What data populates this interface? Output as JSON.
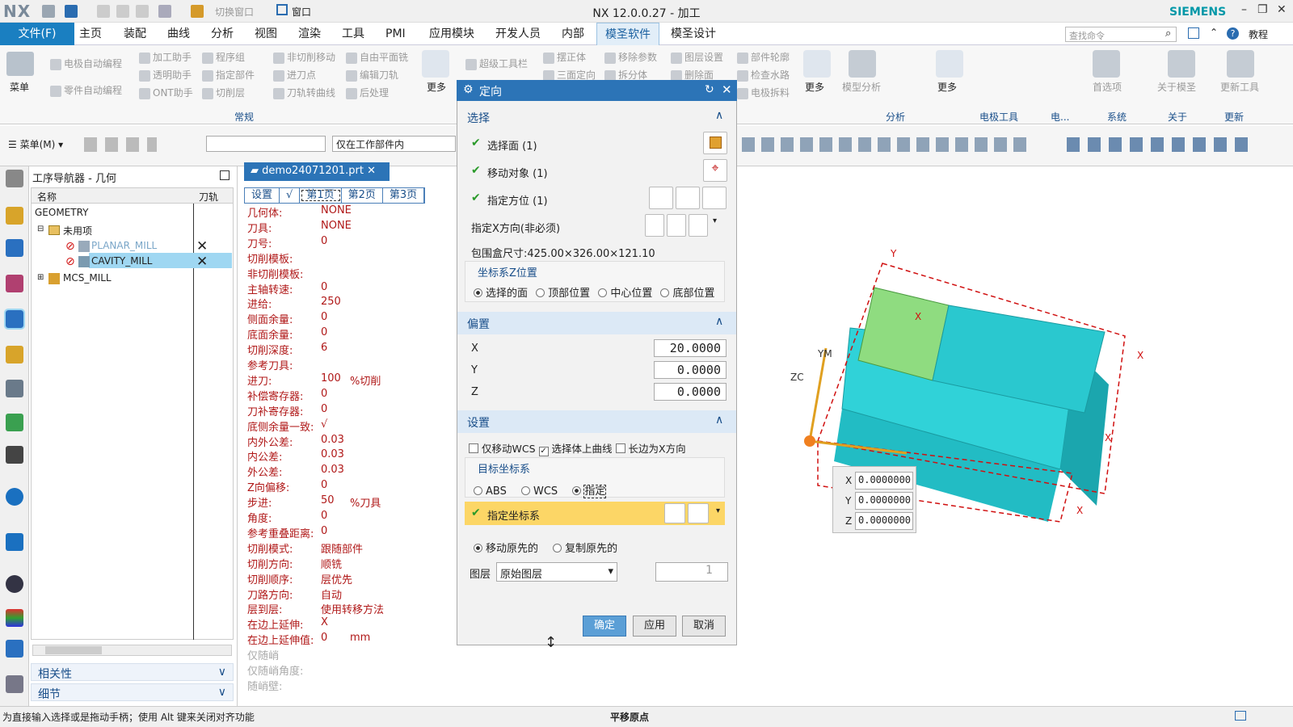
{
  "titlebar": {
    "logo": "NX",
    "title": "NX 12.0.0.27 - 加工",
    "brand": "SIEMENS",
    "switch_window": "切换窗口",
    "window_menu": "窗口"
  },
  "menubar": {
    "file": "文件(F)",
    "tabs": [
      "主页",
      "装配",
      "曲线",
      "分析",
      "视图",
      "渲染",
      "工具",
      "PMI",
      "应用模块",
      "开发人员",
      "内部",
      "模圣软件",
      "模圣设计"
    ],
    "active_tab": "模圣软件",
    "search_placeholder": "查找命令",
    "tutorial": "教程"
  },
  "ribbon": {
    "menu_label": "菜单",
    "group1": [
      "电极自动编程",
      "零件自动编程",
      "加工助手",
      "透明助手",
      "ONT助手",
      "程序组",
      "指定部件",
      "切削层",
      "非切削移动",
      "进刀点",
      "刀轨转曲线",
      "自由平面铣",
      "编辑刀轨",
      "后处理"
    ],
    "more": "更多",
    "group1_name": "常规",
    "group2": [
      "超级工具栏",
      "摆正体",
      "三面定向",
      "移除参数",
      "拆分体",
      "图层设置",
      "删除面",
      "部件轮廓",
      "检查水路",
      "电极拆料"
    ],
    "group3": [
      "模型分析",
      "首选项",
      "关于模圣",
      "更新工具"
    ],
    "group_names": [
      "分析",
      "电极工具",
      "电...",
      "系统",
      "关于",
      "更新"
    ]
  },
  "toolbar2": {
    "menu": "菜单(M)",
    "filter": "仅在工作部件内"
  },
  "navigator": {
    "title": "工序导航器 - 几何",
    "col_name": "名称",
    "col_path": "刀轨",
    "rows": [
      "GEOMETRY",
      "未用项",
      "PLANAR_MILL",
      "CAVITY_MILL",
      "MCS_MILL"
    ],
    "related": "相关性",
    "details": "细节"
  },
  "doc": {
    "tab": "demo24071201.prt"
  },
  "info": {
    "tabs": [
      "设置",
      "√",
      "第1页",
      "第2页",
      "第3页"
    ],
    "rows": [
      {
        "k": "几何体:",
        "v": "NONE"
      },
      {
        "k": "刀具:",
        "v": "NONE"
      },
      {
        "k": "刀号:",
        "v": "0"
      },
      {
        "k": "切削模板:",
        "v": ""
      },
      {
        "k": "非切削模板:",
        "v": ""
      },
      {
        "k": "主轴转速:",
        "v": "0"
      },
      {
        "k": "进给:",
        "v": "250"
      },
      {
        "k": "侧面余量:",
        "v": "0"
      },
      {
        "k": "底面余量:",
        "v": "0"
      },
      {
        "k": "切削深度:",
        "v": "6"
      },
      {
        "k": "参考刀具:",
        "v": ""
      },
      {
        "k": "进刀:",
        "v": "100",
        "u": "%切削"
      },
      {
        "k": "补偿寄存器:",
        "v": "0"
      },
      {
        "k": "刀补寄存器:",
        "v": "0"
      },
      {
        "k": "底侧余量一致:",
        "v": "√"
      },
      {
        "k": "内外公差:",
        "v": "0.03"
      },
      {
        "k": "内公差:",
        "v": "0.03"
      },
      {
        "k": "外公差:",
        "v": "0.03"
      },
      {
        "k": "Z向偏移:",
        "v": "0"
      },
      {
        "k": "步进:",
        "v": "50",
        "u": "%刀具"
      },
      {
        "k": "角度:",
        "v": "0"
      },
      {
        "k": "参考重叠距离:",
        "v": "0"
      },
      {
        "k": "切削模式:",
        "v": "跟随部件"
      },
      {
        "k": "切削方向:",
        "v": "顺铣"
      },
      {
        "k": "切削顺序:",
        "v": "层优先"
      },
      {
        "k": "刀路方向:",
        "v": "自动"
      },
      {
        "k": "层到层:",
        "v": "使用转移方法"
      },
      {
        "k": "在边上延伸:",
        "v": "X"
      },
      {
        "k": "在边上延伸值:",
        "v": "0",
        "u": "mm"
      }
    ],
    "gray_rows": [
      "仅随峭",
      "仅随峭角度:",
      "随峭壁:"
    ]
  },
  "dialog": {
    "title": "定向",
    "sel_section": "选择",
    "sel_face": "选择面 (1)",
    "move_obj": "移动对象 (1)",
    "spec_orient": "指定方位 (1)",
    "spec_x": "指定X方向(非必须)",
    "bbox": "包围盒尺寸:425.00×326.00×121.10",
    "zpos_title": "坐标系Z位置",
    "zpos_opts": [
      "选择的面",
      "顶部位置",
      "中心位置",
      "底部位置"
    ],
    "offset_section": "偏置",
    "x_label": "X",
    "x_val": "20.0000",
    "y_label": "Y",
    "y_val": "0.0000",
    "z_label": "Z",
    "z_val": "0.0000",
    "settings_section": "设置",
    "cb_move_wcs": "仅移动WCS",
    "cb_sel_curve": "选择体上曲线",
    "cb_long_edge": "长边为X方向",
    "target_title": "目标坐标系",
    "target_opts": [
      "ABS",
      "WCS",
      "指定"
    ],
    "spec_csys": "指定坐标系",
    "move_opts": [
      "移动原先的",
      "复制原先的"
    ],
    "layer_label": "图层",
    "layer_val": "原始图层",
    "layer_num": "1",
    "ok": "确定",
    "apply": "应用",
    "cancel": "取消"
  },
  "viewport": {
    "coord_x": "0.0000000",
    "coord_y": "0.0000000",
    "coord_z": "0.0000000",
    "labels": [
      "X",
      "Y",
      "Z"
    ]
  },
  "status": {
    "left": "为直接输入选择或是拖动手柄；使用 Alt 键来关闭对齐功能",
    "center": "平移原点"
  },
  "colors": {
    "accent": "#2c74b7",
    "model": "#30d2d8",
    "highlight": "#fcd666"
  }
}
